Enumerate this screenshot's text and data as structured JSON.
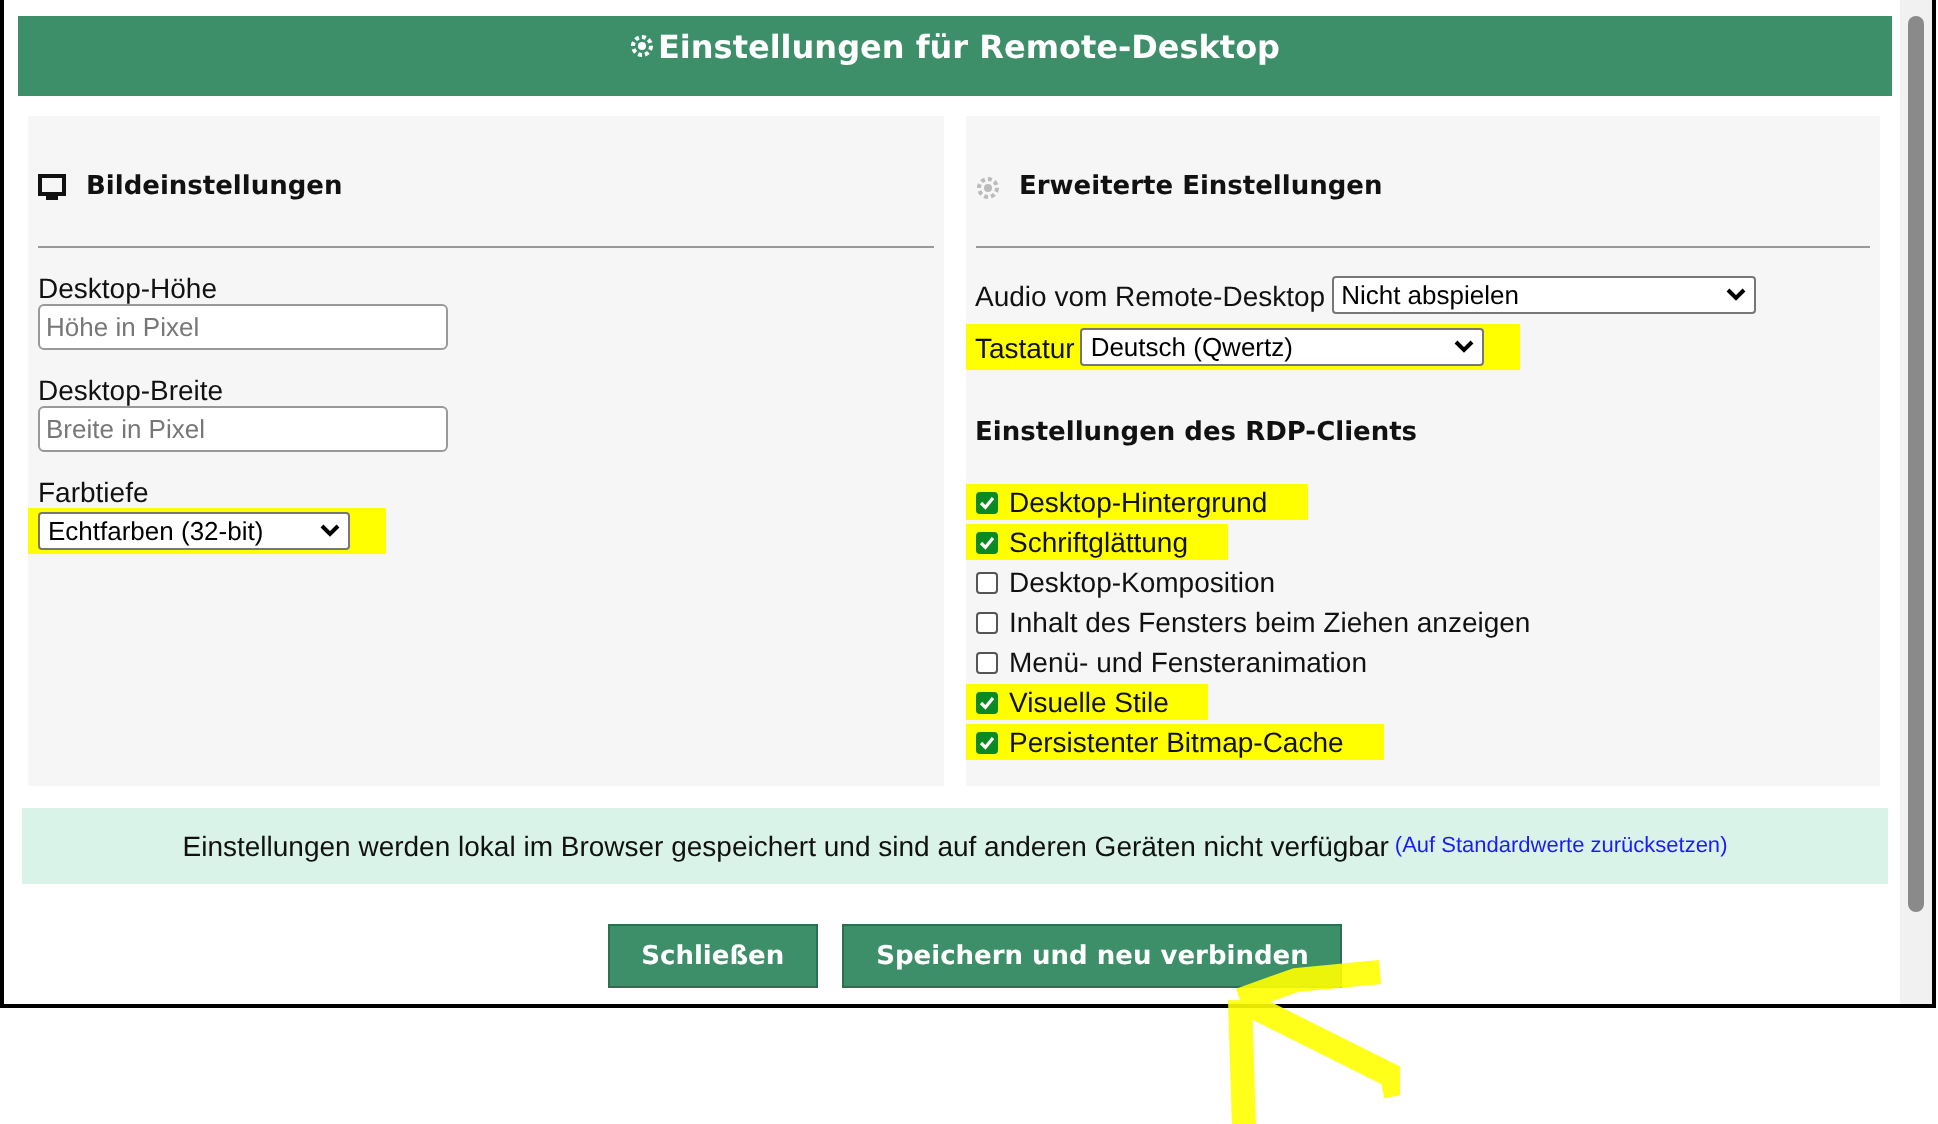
{
  "dialog": {
    "title": "Einstellungen für Remote-Desktop"
  },
  "image_settings": {
    "heading": "Bildeinstellungen",
    "fields": [
      {
        "kind": "input",
        "label": "Desktop-Höhe",
        "placeholder": "Höhe in Pixel",
        "highlighted": false
      },
      {
        "kind": "input",
        "label": "Desktop-Breite",
        "placeholder": "Breite in Pixel",
        "highlighted": false
      },
      {
        "kind": "select",
        "label": "Farbtiefe",
        "value": "Echtfarben (32-bit)",
        "highlighted": true
      }
    ]
  },
  "advanced_settings": {
    "heading": "Erweiterte Einstellungen",
    "selects": [
      {
        "label": "Audio vom Remote-Desktop",
        "value": "Nicht abspielen",
        "highlighted": false
      },
      {
        "label": "Tastatur",
        "value": "Deutsch (Qwertz)",
        "highlighted": true
      }
    ],
    "rdp_heading": "Einstellungen des RDP-Clients",
    "options": [
      {
        "label": "Desktop-Hintergrund",
        "checked": true,
        "highlighted": true
      },
      {
        "label": "Schriftglättung",
        "checked": true,
        "highlighted": true
      },
      {
        "label": "Desktop-Komposition",
        "checked": false,
        "highlighted": false
      },
      {
        "label": "Inhalt des Fensters beim Ziehen anzeigen",
        "checked": false,
        "highlighted": false
      },
      {
        "label": "Menü- und Fensteranimation",
        "checked": false,
        "highlighted": false
      },
      {
        "label": "Visuelle Stile",
        "checked": true,
        "highlighted": true
      },
      {
        "label": "Persistenter Bitmap-Cache",
        "checked": true,
        "highlighted": true
      }
    ]
  },
  "info_bar": {
    "text": "Einstellungen werden lokal im Browser gespeichert und sind auf anderen Geräten nicht verfügbar",
    "open_paren": "(",
    "link": "Auf Standardwerte zurücksetzen",
    "close_paren": ")"
  },
  "buttons": [
    {
      "label": "Schließen"
    },
    {
      "label": "Speichern und neu verbinden"
    }
  ]
}
